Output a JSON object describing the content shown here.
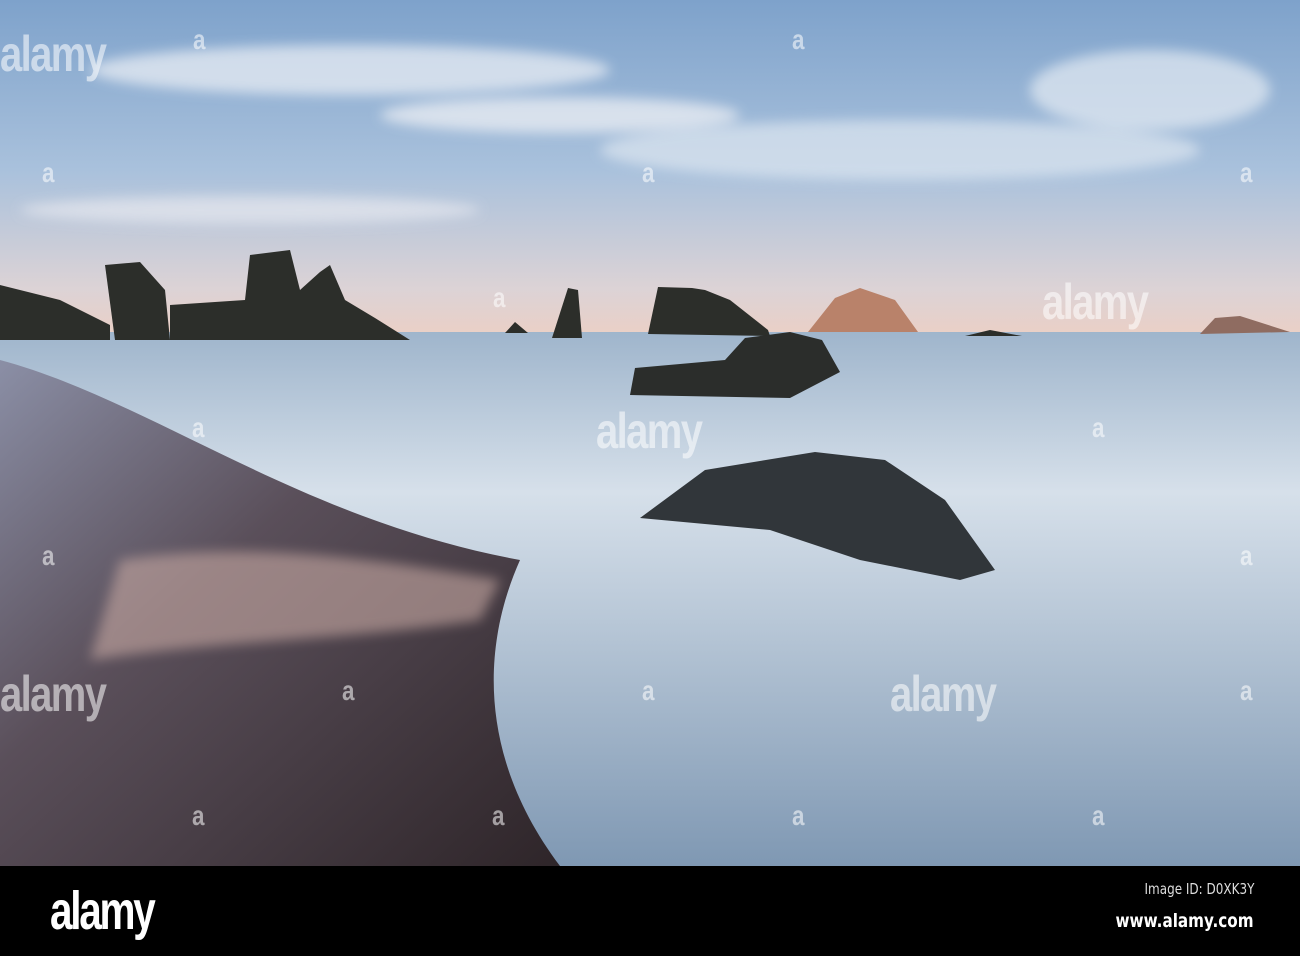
{
  "photo": {
    "subject": "Rocky beach at dusk with sea stacks and surf",
    "colors": {
      "sky_top": "#7fa3cc",
      "sky_horizon": "#e9d2c8",
      "sea": "#b9cbdb",
      "sand": "#3d3438",
      "rock": "#2e302c"
    }
  },
  "watermark": {
    "word": "alamy",
    "letter": "a"
  },
  "footer": {
    "logo": "alamy",
    "image_id": "Image ID: D0XK3Y",
    "url": "www.alamy.com"
  }
}
